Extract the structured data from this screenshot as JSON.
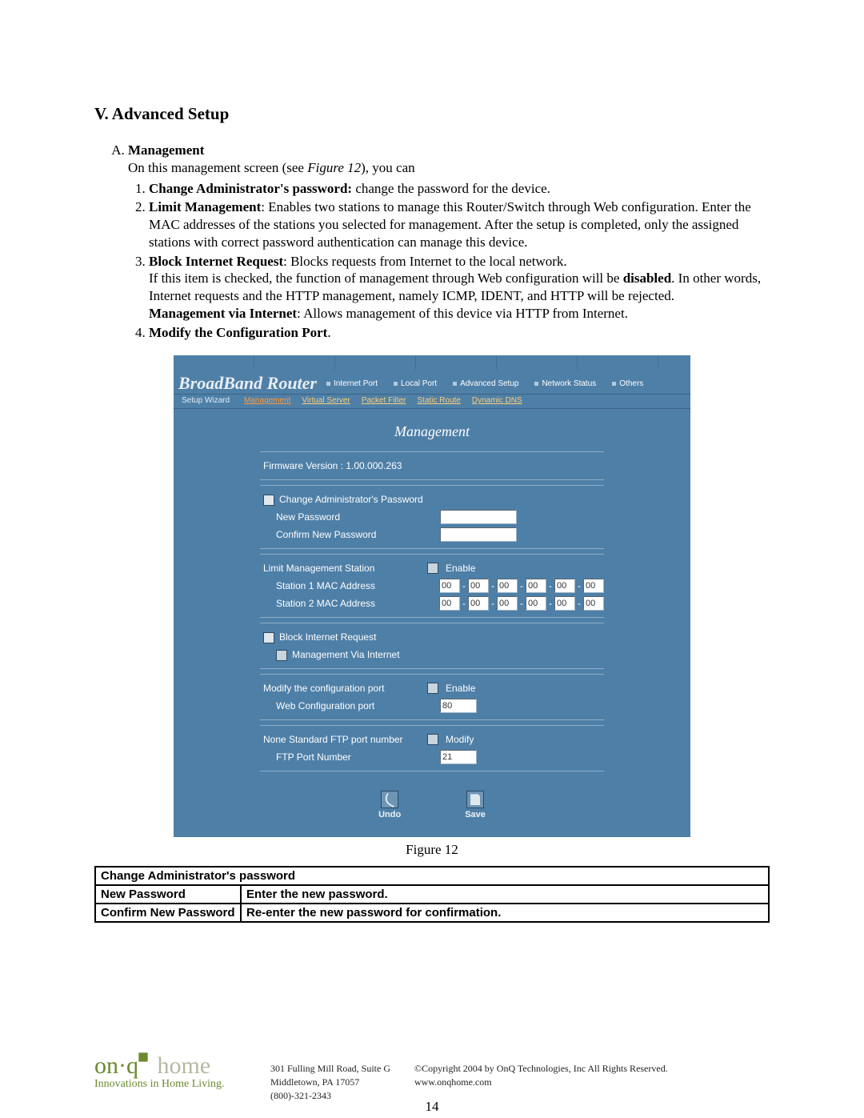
{
  "heading": "V.  Advanced Setup",
  "sectionA": {
    "label": "Management",
    "intro_a": "On this management screen (see ",
    "intro_fig": "Figure 12",
    "intro_b": "), you can",
    "items": [
      {
        "bold": "Change Administrator's password:",
        "rest": " change the password for the device."
      },
      {
        "bold": "Limit Management",
        "rest": ": Enables two stations to manage this Router/Switch through Web configuration. Enter the MAC addresses of the stations you selected for management. After the setup is completed, only the assigned stations with correct password authentication can manage this device."
      },
      {
        "bold": "Block Internet Request",
        "rest": ": Blocks requests from Internet to the local network.",
        "para_a": "If this item is checked, the function of management through Web configuration will be ",
        "para_bold": "disabled",
        "para_b": ". In other words, Internet requests and the HTTP management, namely ICMP, IDENT, and HTTP will be rejected.",
        "para2_bold": "Management via Internet",
        "para2_rest": ": Allows management of this device via HTTP from Internet."
      },
      {
        "bold": "Modify the Configuration Port",
        "rest": "."
      }
    ]
  },
  "router": {
    "logo": "BroadBand Router",
    "nav": [
      "Internet Port",
      "Local Port",
      "Advanced Setup",
      "Network Status",
      "Others"
    ],
    "wizard": "Setup Wizard",
    "subnav": [
      "Management",
      "Virtual Server",
      "Packet Filter",
      "Static Route",
      "Dynamic DNS"
    ],
    "panel_title": "Management",
    "firmware": "Firmware Version : 1.00.000.263",
    "change_pw": "Change Administrator's Password",
    "new_pw": "New Password",
    "confirm_pw": "Confirm New Password",
    "limit": "Limit Management Station",
    "enable": "Enable",
    "st1": "Station 1 MAC Address",
    "st2": "Station 2 MAC Address",
    "mac": "00",
    "block": "Block Internet Request",
    "mvi": "Management Via Internet",
    "modport": "Modify the configuration port",
    "webport_lbl": "Web Configuration port",
    "webport_val": "80",
    "ftp_lbl": "None Standard FTP port number",
    "modify": "Modify",
    "ftpport_lbl": "FTP Port Number",
    "ftpport_val": "21",
    "undo": "Undo",
    "save": "Save"
  },
  "figure_caption": "Figure 12",
  "table": {
    "header": "Change Administrator's password",
    "r1c1": "New Password",
    "r1c2": "Enter the new password.",
    "r2c1": "Confirm New Password",
    "r2c2": "Re-enter the new password for confirmation."
  },
  "footer": {
    "brand_a": "on",
    "brand_dot": "·",
    "brand_b": "q",
    "brand_home": " home",
    "tagline": "Innovations in Home Living.",
    "addr1": "301 Fulling Mill Road, Suite G",
    "addr2": "Middletown, PA   17057",
    "phone": "(800)-321-2343",
    "copy": "©Copyright 2004 by OnQ Technologies, Inc All Rights Reserved.",
    "url": "www.onqhome.com"
  },
  "page_number": "14"
}
